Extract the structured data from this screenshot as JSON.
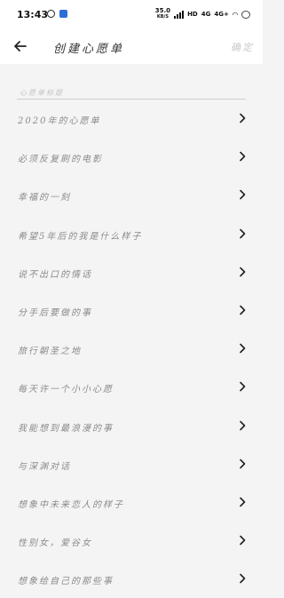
{
  "status": {
    "time": "13:43",
    "net_speed": "35.0",
    "net_unit": "KB/S",
    "hd": "HD",
    "signal_a": "4G",
    "signal_b": "4G+"
  },
  "header": {
    "title": "创建心愿单",
    "confirm_label": "确定"
  },
  "form": {
    "name_placeholder": "心愿单标题"
  },
  "list": [
    {
      "label": "2020年的心愿单"
    },
    {
      "label": "必须反复刷的电影"
    },
    {
      "label": "幸福的一刻"
    },
    {
      "label": "希望5年后的我是什么样子"
    },
    {
      "label": "说不出口的情话"
    },
    {
      "label": "分手后要做的事"
    },
    {
      "label": "旅行朝圣之地"
    },
    {
      "label": "每天许一个小小心愿"
    },
    {
      "label": "我能想到最浪漫的事"
    },
    {
      "label": "与深渊对话"
    },
    {
      "label": "想象中未来恋人的样子"
    },
    {
      "label": "性别女，爱谷女"
    },
    {
      "label": "想象给自己的那些事"
    }
  ],
  "colors": {
    "background": "#f4f4f4",
    "bar": "#ffffff",
    "label": "#8a8a8a",
    "confirm_disabled": "#c8c8c8"
  },
  "icons": [
    "back-arrow-icon",
    "chevron-right-icon",
    "message-icon",
    "app-notification-icon",
    "signal-icon",
    "wifi-icon",
    "battery-icon"
  ]
}
